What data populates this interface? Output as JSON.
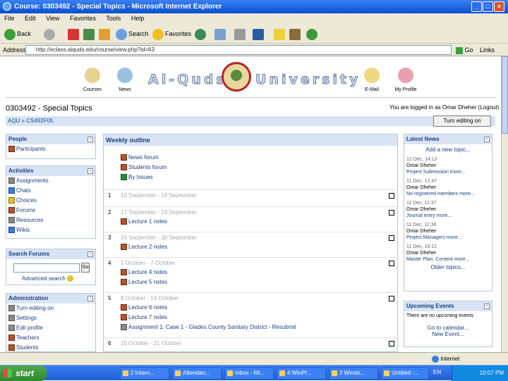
{
  "window": {
    "title": "Course: 0303492 - Special Topics - Microsoft Internet Explorer"
  },
  "menu": [
    "File",
    "Edit",
    "View",
    "Favorites",
    "Tools",
    "Help"
  ],
  "toolbar": {
    "back": "Back",
    "search": "Search",
    "favorites": "Favorites"
  },
  "address": {
    "label": "Address",
    "url": "http://eclass.alquds.edu/course/view.php?id=63",
    "go": "Go",
    "links": "Links"
  },
  "header": {
    "courses": "Courses",
    "news": "News",
    "email": "E-Mail",
    "profile": "My Profile",
    "univ_left": "Al-Quds",
    "univ_right": "University"
  },
  "course": {
    "title": "0303492 - Special Topics",
    "logged": "You are logged in as Omar Dheher (Logout)",
    "breadcrumb": "AQU » CS492F05",
    "turn_edit": "Turn editing on"
  },
  "people": {
    "title": "People",
    "items": [
      "Participants"
    ]
  },
  "activities": {
    "title": "Activities",
    "items": [
      "Assignments",
      "Chats",
      "Choices",
      "Forums",
      "Resources",
      "Wikis"
    ]
  },
  "search_forums": {
    "title": "Search Forums",
    "go": "Go",
    "advanced": "Advanced search"
  },
  "admin": {
    "title": "Administration",
    "items": [
      "Turn editing on",
      "Settings",
      "Edit profile",
      "Teachers",
      "Students"
    ]
  },
  "weekly": {
    "title": "Weekly outline",
    "top_items": [
      "News forum",
      "Students forum",
      "By Issues"
    ],
    "weeks": [
      {
        "num": "1",
        "date": "10 September - 16 September",
        "items": []
      },
      {
        "num": "2",
        "date": "17 September - 23 September",
        "items": [
          "Lecture 1 notes"
        ]
      },
      {
        "num": "3",
        "date": "24 September - 30 September",
        "items": [
          "Lecture 2 notes"
        ]
      },
      {
        "num": "4",
        "date": "1 October - 7 October",
        "items": [
          "Lecture 4 notes",
          "Lecture 5 notes"
        ]
      },
      {
        "num": "5",
        "date": "8 October - 14 October",
        "items": [
          "Lecture 6 notes",
          "Lecture 7 notes",
          "Assignment 1: Case 1 - Glades County Sanitary District - Resubmit"
        ]
      },
      {
        "num": "6",
        "date": "15 October - 21 October",
        "items": []
      }
    ]
  },
  "latest_news": {
    "title": "Latest News",
    "add": "Add a new topic...",
    "posts": [
      {
        "date": "12 Dec, 14:12",
        "author": "Omar Dheher",
        "text": "Project Submission more..."
      },
      {
        "date": "11 Dec, 12:47",
        "author": "Omar Dheher",
        "text": "No registered members more..."
      },
      {
        "date": "11 Dec, 11:37",
        "author": "Omar Dheher",
        "text": "Journal entry more..."
      },
      {
        "date": "11 Dec, 11:36",
        "author": "Omar Dheher",
        "text": "Project Managers more..."
      },
      {
        "date": "11 Dec, 16:12",
        "author": "Omar Dheher",
        "text": "Master Plan, Content more..."
      }
    ],
    "older": "Older topics..."
  },
  "upcoming": {
    "title": "Upcoming Events",
    "text": "There are no upcoming events",
    "calendar": "Go to calendar...",
    "new_event": "New Event..."
  },
  "status": {
    "zone": "Internet"
  },
  "taskbar": {
    "start": "start",
    "tasks": [
      "2 Intern...",
      "Attendan...",
      "Inbox - Mi...",
      "4 WinPr...",
      "2 Windo...",
      "Untitled -..."
    ],
    "lang": "EN",
    "clock": "10:07 PM"
  }
}
